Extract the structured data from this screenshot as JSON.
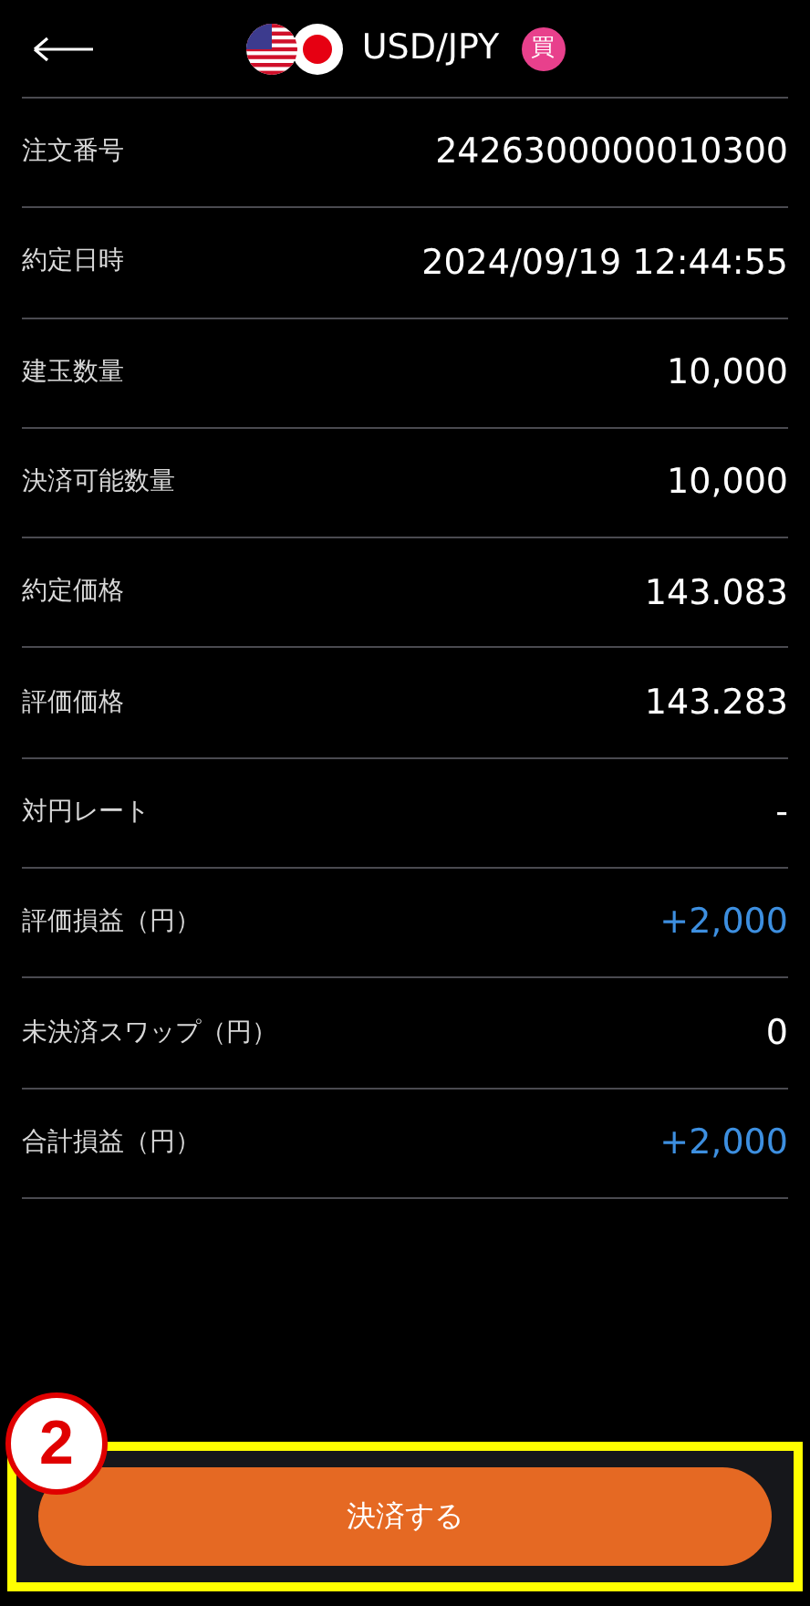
{
  "header": {
    "pair": "USD/JPY",
    "side_badge": "買"
  },
  "rows": [
    {
      "label": "注文番号",
      "value": "2426300000010300",
      "positive": false
    },
    {
      "label": "約定日時",
      "value": "2024/09/19 12:44:55",
      "positive": false
    },
    {
      "label": "建玉数量",
      "value": "10,000",
      "positive": false
    },
    {
      "label": "決済可能数量",
      "value": "10,000",
      "positive": false
    },
    {
      "label": "約定価格",
      "value": "143.083",
      "positive": false
    },
    {
      "label": "評価価格",
      "value": "143.283",
      "positive": false
    },
    {
      "label": "対円レート",
      "value": "-",
      "positive": false
    },
    {
      "label": "評価損益（円）",
      "value": "+2,000",
      "positive": true
    },
    {
      "label": "未決済スワップ（円）",
      "value": "0",
      "positive": false
    },
    {
      "label": "合計損益（円）",
      "value": "+2,000",
      "positive": true
    }
  ],
  "footer": {
    "button": "決済する",
    "step_marker": "2",
    "highlighted": true
  }
}
